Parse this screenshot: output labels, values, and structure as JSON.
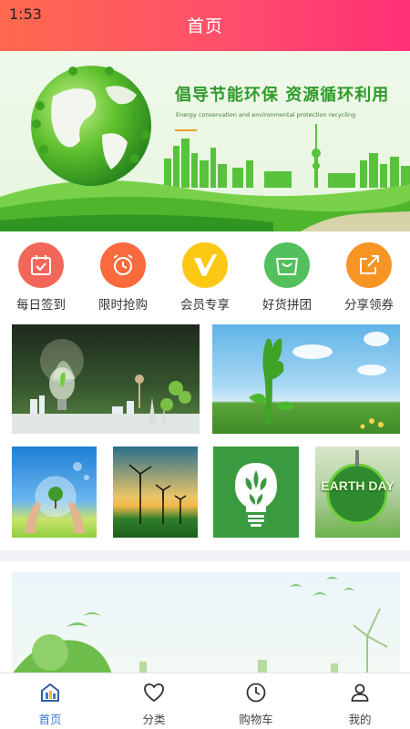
{
  "status_bar": {
    "time": "1:53"
  },
  "header": {
    "title": "首页"
  },
  "banner": {
    "headline": "倡导节能环保 资源循环利用",
    "subline": "Energy conservation and environmental protection recycling"
  },
  "quick_menu": [
    {
      "label": "每日签到",
      "icon": "calendar-check-icon",
      "color": "#f2675a"
    },
    {
      "label": "限时抢购",
      "icon": "alarm-clock-icon",
      "color": "#fb6a3c"
    },
    {
      "label": "会员专享",
      "icon": "vip-v-icon",
      "color": "#fcc814"
    },
    {
      "label": "好货拼团",
      "icon": "shopping-bag-icon",
      "color": "#52c05c"
    },
    {
      "label": "分享领券",
      "icon": "share-icon",
      "color": "#f79424"
    }
  ],
  "poster": {
    "text": "EARTH DAY"
  },
  "bottom_nav": [
    {
      "label": "首页",
      "icon": "home-icon",
      "active": true
    },
    {
      "label": "分类",
      "icon": "heart-icon",
      "active": false
    },
    {
      "label": "购物车",
      "icon": "clock-icon",
      "active": false
    },
    {
      "label": "我的",
      "icon": "user-icon",
      "active": false
    }
  ],
  "colors": {
    "header_start": "#ff6a4d",
    "header_end": "#ff2f78",
    "nav_active": "#3a7bd5",
    "eco_green": "#3c9a34"
  }
}
